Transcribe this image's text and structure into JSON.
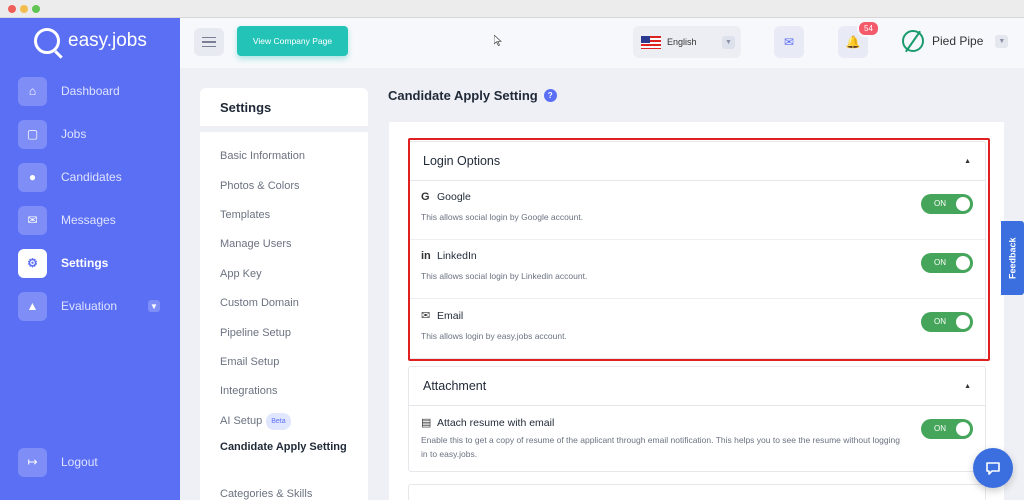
{
  "window": {
    "dot_colors": [
      "#ee5f57",
      "#f4bd4f",
      "#5fc453"
    ]
  },
  "brand": {
    "name": "easy.jobs"
  },
  "sidebar": {
    "items": [
      {
        "label": "Dashboard",
        "icon": "home-icon"
      },
      {
        "label": "Jobs",
        "icon": "briefcase-icon"
      },
      {
        "label": "Candidates",
        "icon": "user-icon"
      },
      {
        "label": "Messages",
        "icon": "chat-icon"
      },
      {
        "label": "Settings",
        "icon": "gear-icon",
        "active": true
      },
      {
        "label": "Evaluation",
        "icon": "graduation-cap-icon",
        "expandable": true
      }
    ],
    "logout_label": "Logout"
  },
  "topbar": {
    "view_company_label": "View Company Page",
    "language": "English",
    "notification_count": "54",
    "company_name": "Pied Pipe"
  },
  "settings_nav": {
    "title": "Settings",
    "items": [
      "Basic Information",
      "Photos & Colors",
      "Templates",
      "Manage Users",
      "App Key",
      "Custom Domain",
      "Pipeline Setup",
      "Email Setup",
      "Integrations",
      "AI Setup",
      "Candidate Apply Setting",
      "Categories & Skills"
    ],
    "beta_label": "Beta",
    "active_item": "Candidate Apply Setting"
  },
  "main": {
    "title": "Candidate Apply Setting",
    "login_options": {
      "title": "Login Options",
      "options": [
        {
          "icon": "G",
          "name": "Google",
          "desc": "This allows social login by Google account.",
          "state": "ON"
        },
        {
          "icon": "in",
          "name": "LinkedIn",
          "desc": "This allows social login by Linkedin account.",
          "state": "ON"
        },
        {
          "icon": "✉",
          "name": "Email",
          "desc": "This allows login by easy.jobs account.",
          "state": "ON"
        }
      ]
    },
    "attachment": {
      "title": "Attachment",
      "option": {
        "name": "Attach resume with email",
        "desc": "Enable this to get a copy of resume of the applicant through email notification. This helps you to see the resume without logging in to easy.jobs.",
        "state": "ON"
      }
    }
  },
  "feedback_label": "Feedback",
  "colors": {
    "sidebar": "#5b6ff5",
    "accent": "#23c4b7",
    "toggle_on": "#45a55a",
    "highlight": "#e02020"
  }
}
